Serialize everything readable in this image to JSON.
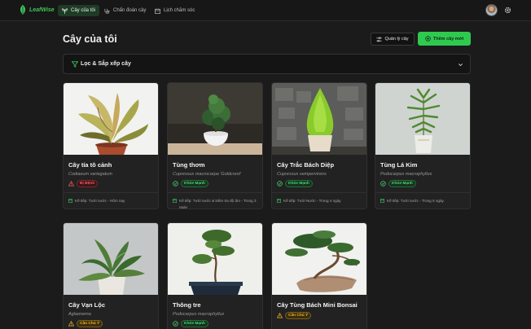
{
  "nav": {
    "brand": "LeafWise",
    "tabs": [
      {
        "label": "Cây của tôi",
        "icon": "sprout-icon",
        "active": true
      },
      {
        "label": "Chẩn đoán cây",
        "icon": "stethoscope-icon",
        "active": false
      },
      {
        "label": "Lịch chăm sóc",
        "icon": "calendar-icon",
        "active": false
      }
    ]
  },
  "page": {
    "title": "Cây của tôi",
    "manage_label": "Quản lý cây",
    "add_label": "Thêm cây mới"
  },
  "filter": {
    "label": "Lọc & Sắp xếp cây"
  },
  "colors": {
    "accent": "#2fc94f",
    "sick": "#ff5b5b",
    "healthy": "#4fd772",
    "warn": "#f2b529"
  },
  "plants": [
    {
      "name": "Cây tía tô cảnh",
      "scientific": "Codiaeum variegatum",
      "status": "Bị Bệnh",
      "status_type": "sick",
      "next": "Kế tiếp: Tưới nước - Hôm nay"
    },
    {
      "name": "Tùng thơm",
      "scientific": "Cupressus macrocarpa 'Goldcrest'",
      "status": "Khỏe Mạnh",
      "status_type": "healthy",
      "next": "Kế tiếp: Tưới nước &amp; kiểm tra độ ẩm - Trong 3 ngày"
    },
    {
      "name": "Cây Trắc Bách Diệp",
      "scientific": "Cupressus sempervirens",
      "status": "Khỏe Mạnh",
      "status_type": "healthy",
      "next": "Kế tiếp: Tưới Nước - Trong 4 ngày"
    },
    {
      "name": "Tùng Lá Kim",
      "scientific": "Podocarpus macrophyllus",
      "status": "Khỏe Mạnh",
      "status_type": "healthy",
      "next": "Kế tiếp: Tưới nước - Trong 5 ngày"
    },
    {
      "name": "Cây Vạn Lộc",
      "scientific": "Aglaonema",
      "status": "Cần Chú Ý",
      "status_type": "warn",
      "next": ""
    },
    {
      "name": "Thông tre",
      "scientific": "Podocarpus macrophyllus",
      "status": "Khỏe Mạnh",
      "status_type": "healthy",
      "next": ""
    },
    {
      "name": "Cây Tùng Bách Mini Bonsai",
      "scientific": "",
      "status": "Cần Chú Ý",
      "status_type": "warn",
      "next": ""
    }
  ]
}
